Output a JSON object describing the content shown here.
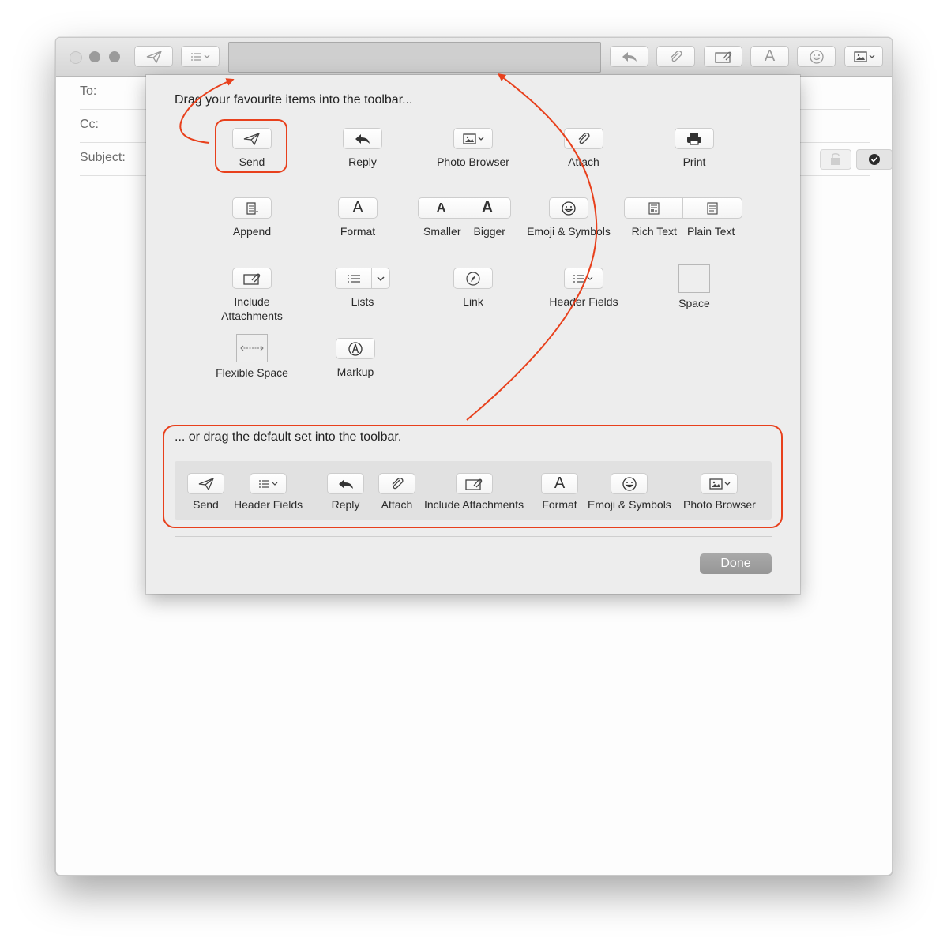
{
  "window": {
    "fields": [
      {
        "label": "To:"
      },
      {
        "label": "Cc:"
      },
      {
        "label": "Subject:"
      }
    ]
  },
  "sheet": {
    "heading": "Drag your favourite items into the toolbar...",
    "items": [
      {
        "label": "Send",
        "icon": "send-icon"
      },
      {
        "label": "Reply",
        "icon": "reply-icon"
      },
      {
        "label": "Photo Browser",
        "icon": "photo-browser-icon"
      },
      {
        "label": "Attach",
        "icon": "paperclip-icon"
      },
      {
        "label": "Print",
        "icon": "printer-icon"
      },
      {
        "label": "Append",
        "icon": "append-icon"
      },
      {
        "label": "Format",
        "icon": "format-icon"
      },
      {
        "label": "Smaller",
        "icon": "smaller-font-icon"
      },
      {
        "label": "Bigger",
        "icon": "bigger-font-icon"
      },
      {
        "label": "Emoji & Symbols",
        "icon": "emoji-icon"
      },
      {
        "label": "Rich Text",
        "icon": "rich-text-icon"
      },
      {
        "label": "Plain Text",
        "icon": "plain-text-icon"
      },
      {
        "label": "Include\nAttachments",
        "icon": "include-attachments-icon"
      },
      {
        "label": "Lists",
        "icon": "list-icon"
      },
      {
        "label": "Link",
        "icon": "link-compass-icon"
      },
      {
        "label": "Header Fields",
        "icon": "header-fields-icon"
      },
      {
        "label": "Space",
        "icon": "space-icon"
      },
      {
        "label": "Flexible Space",
        "icon": "flexible-space-icon"
      },
      {
        "label": "Markup",
        "icon": "markup-icon"
      }
    ],
    "default_heading": "... or drag the default set into the toolbar.",
    "default_set": [
      {
        "label": "Send"
      },
      {
        "label": "Header Fields"
      },
      {
        "label": "Reply"
      },
      {
        "label": "Attach"
      },
      {
        "label": "Include Attachments"
      },
      {
        "label": "Format"
      },
      {
        "label": "Emoji & Symbols"
      },
      {
        "label": "Photo Browser"
      }
    ],
    "done_label": "Done"
  },
  "colors": {
    "annotation": "#e8401c",
    "done_button": "#9f9f9f"
  }
}
